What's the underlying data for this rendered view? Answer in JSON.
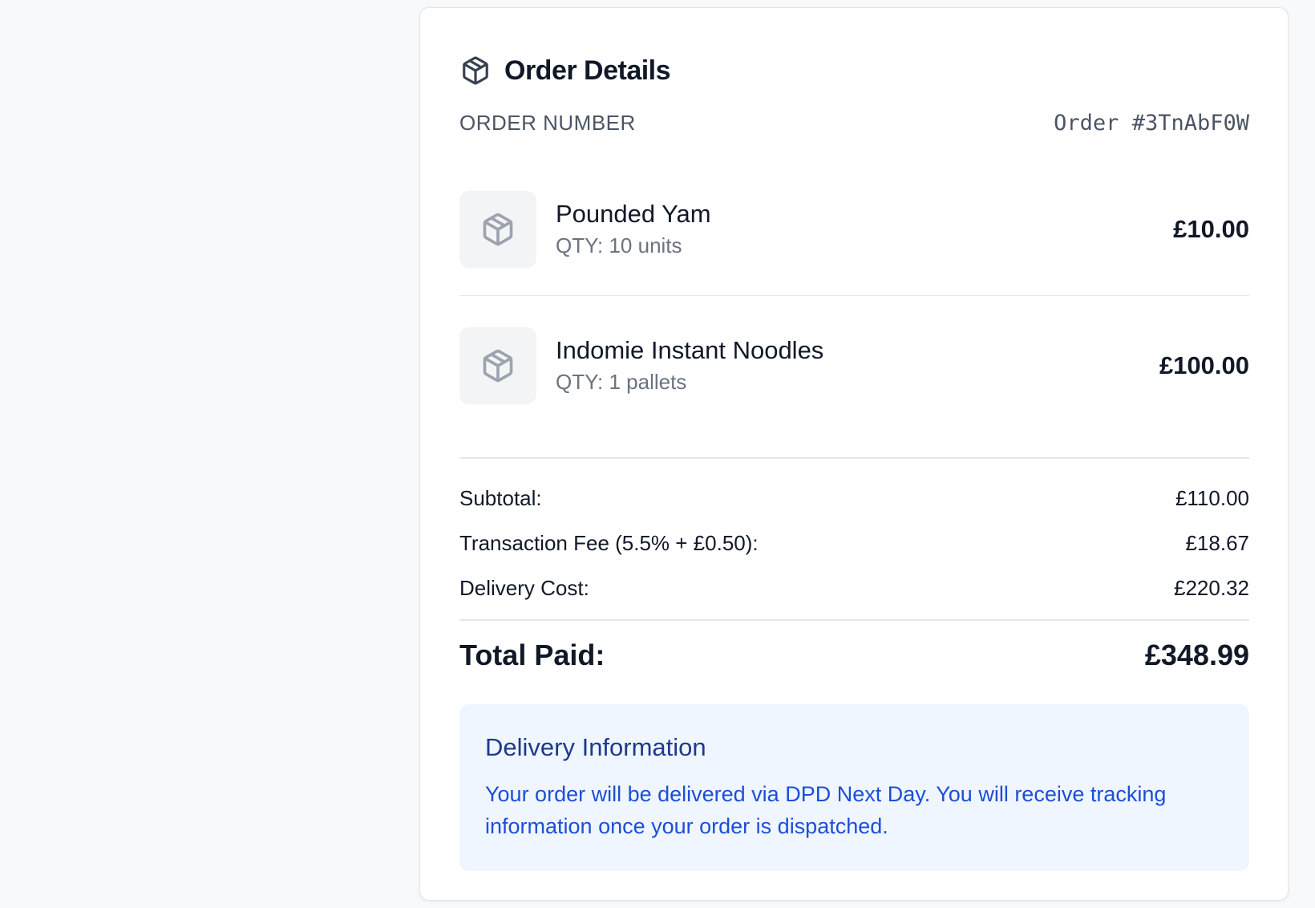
{
  "header": {
    "title": "Order Details",
    "icon": "package-icon"
  },
  "order": {
    "label": "ORDER NUMBER",
    "value": "Order #3TnAbF0W"
  },
  "items": [
    {
      "name": "Pounded Yam",
      "qty": "QTY: 10 units",
      "price": "£10.00",
      "icon": "package-icon"
    },
    {
      "name": "Indomie Instant Noodles",
      "qty": "QTY: 1 pallets",
      "price": "£100.00",
      "icon": "package-icon"
    }
  ],
  "summary": {
    "subtotal_label": "Subtotal:",
    "subtotal_value": "£110.00",
    "fee_label": "Transaction Fee (5.5% + £0.50):",
    "fee_value": "£18.67",
    "delivery_label": "Delivery Cost:",
    "delivery_value": "£220.32",
    "total_label": "Total Paid:",
    "total_value": "£348.99"
  },
  "delivery": {
    "title": "Delivery Information",
    "text": "Your order will be delivered via DPD Next Day. You will receive tracking information once your order is dispatched."
  },
  "colors": {
    "background": "#f8f9fb",
    "card": "#ffffff",
    "delivery_bg": "#eff6ff",
    "delivery_title": "#1e3a8a",
    "delivery_text": "#1d4ed8"
  }
}
